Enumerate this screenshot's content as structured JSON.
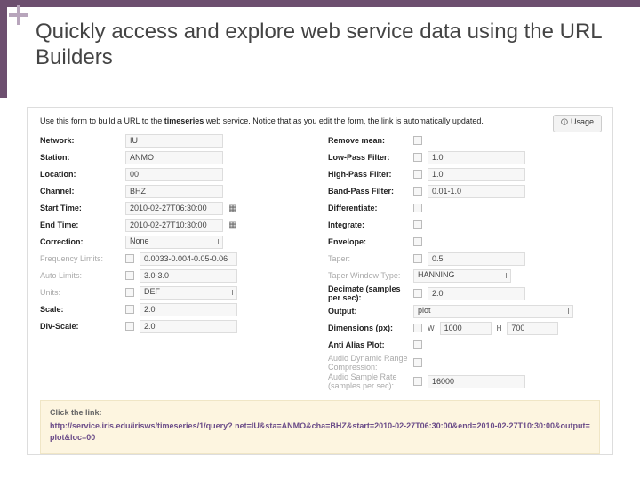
{
  "plus_icon": "+",
  "title": "Quickly access and explore web service data using the URL Builders",
  "intro_pre": "Use this form to build a URL to the ",
  "intro_bold": "timeseries",
  "intro_post": " web service. Notice that as you edit the form, the link is automatically updated.",
  "usage_btn": "Usage",
  "left": {
    "network_l": "Network:",
    "network_v": "IU",
    "station_l": "Station:",
    "station_v": "ANMO",
    "location_l": "Location:",
    "location_v": "00",
    "channel_l": "Channel:",
    "channel_v": "BHZ",
    "start_l": "Start Time:",
    "start_v": "2010-02-27T06:30:00",
    "end_l": "End Time:",
    "end_v": "2010-02-27T10:30:00",
    "corr_l": "Correction:",
    "corr_v": "None",
    "freq_l": "Frequency Limits:",
    "freq_v": "0.0033-0.004-0.05-0.06",
    "auto_l": "Auto Limits:",
    "auto_v": "3.0-3.0",
    "units_l": "Units:",
    "units_v": "DEF",
    "scale_l": "Scale:",
    "scale_v": "2.0",
    "div_l": "Div-Scale:",
    "div_v": "2.0"
  },
  "right": {
    "rmean_l": "Remove mean:",
    "lp_l": "Low-Pass Filter:",
    "lp_v": "1.0",
    "hp_l": "High-Pass Filter:",
    "hp_v": "1.0",
    "bp_l": "Band-Pass Filter:",
    "bp_v": "0.01-1.0",
    "diff_l": "Differentiate:",
    "int_l": "Integrate:",
    "env_l": "Envelope:",
    "tap_l": "Taper:",
    "tap_v": "0.5",
    "twt_l": "Taper Window Type:",
    "twt_v": "HANNING",
    "dec_l": "Decimate (samples per sec):",
    "dec_v": "2.0",
    "out_l": "Output:",
    "out_v": "plot",
    "dim_l": "Dimensions (px):",
    "dim_w_l": "W",
    "dim_w_v": "1000",
    "dim_h_l": "H",
    "dim_h_v": "700",
    "aa_l": "Anti Alias Plot:",
    "adrc_l": "Audio Dynamic Range Compression:",
    "asr_l": "Audio Sample Rate (samples per sec):",
    "asr_v": "16000"
  },
  "linkbox": {
    "title": "Click the link:",
    "url": "http://service.iris.edu/irisws/timeseries/1/query? net=IU&sta=ANMO&cha=BHZ&start=2010-02-27T06:30:00&end=2010-02-27T10:30:00&output=plot&loc=00"
  }
}
